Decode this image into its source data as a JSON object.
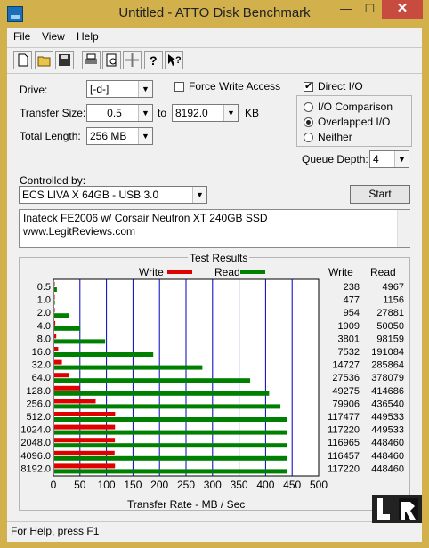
{
  "window": {
    "title": "Untitled - ATTO Disk Benchmark",
    "minimize": "—",
    "maximize": "☐",
    "close": "✕"
  },
  "menu": {
    "file": "File",
    "view": "View",
    "help": "Help"
  },
  "toolbar": {
    "new": "new-doc",
    "open": "open-folder",
    "save": "save-disk",
    "print": "printer",
    "preview": "print-preview",
    "move": "move-arrows",
    "help": "question",
    "context_help": "context-help"
  },
  "form": {
    "drive_label": "Drive:",
    "drive_value": "[-d-]",
    "force_write_label": "Force Write Access",
    "direct_io_label": "Direct I/O",
    "transfer_size_label": "Transfer Size:",
    "transfer_from": "0.5",
    "to_label": "to",
    "transfer_to": "8192.0",
    "kb_label": "KB",
    "total_length_label": "Total Length:",
    "total_length_value": "256 MB",
    "io_comparison_label": "I/O Comparison",
    "overlapped_io_label": "Overlapped I/O",
    "neither_label": "Neither",
    "queue_depth_label": "Queue Depth:",
    "queue_depth_value": "4",
    "controlled_by_label": "Controlled by:",
    "controlled_by_value": "ECS LIVA X 64GB - USB 3.0",
    "start_label": "Start",
    "notes_line1": "Inateck FE2006 w/ Corsair Neutron XT 240GB SSD",
    "notes_line2": "www.LegitReviews.com"
  },
  "results": {
    "group_title": "Test Results",
    "legend_write": "Write",
    "legend_read": "Read",
    "col_write": "Write",
    "col_read": "Read",
    "xaxis_label": "Transfer Rate - MB / Sec"
  },
  "status": {
    "text": "For Help, press F1"
  },
  "colors": {
    "write": "#e00000",
    "read": "#008000",
    "grid": "#0000c0"
  },
  "chart_data": {
    "type": "bar",
    "categories": [
      "0.5",
      "1.0",
      "2.0",
      "4.0",
      "8.0",
      "16.0",
      "32.0",
      "64.0",
      "128.0",
      "256.0",
      "512.0",
      "1024.0",
      "2048.0",
      "4096.0",
      "8192.0"
    ],
    "series": [
      {
        "name": "Write",
        "values": [
          238,
          477,
          954,
          1909,
          3801,
          7532,
          14727,
          27536,
          49275,
          79906,
          117477,
          117220,
          116965,
          116457,
          117220
        ]
      },
      {
        "name": "Read",
        "values": [
          4967,
          1156,
          27881,
          50050,
          98159,
          191084,
          285864,
          378079,
          414686,
          436540,
          449533,
          449533,
          448460,
          448460,
          448460
        ]
      }
    ],
    "value_units": "KB/s",
    "write_display": [
      "238",
      "477",
      "954",
      "1909",
      "3801",
      "7532",
      "14727",
      "27536",
      "49275",
      "79906",
      "117477",
      "117220",
      "116965",
      "116457",
      "117220"
    ],
    "read_display": [
      "4967",
      "1156",
      "27881",
      "50050",
      "98159",
      "191084",
      "285864",
      "378079",
      "414686",
      "436540",
      "449533",
      "449533",
      "448460",
      "448460",
      "448460"
    ],
    "xlabel": "Transfer Rate - MB / Sec",
    "xticks": [
      "0",
      "50",
      "100",
      "150",
      "200",
      "250",
      "300",
      "350",
      "400",
      "450",
      "500"
    ],
    "xlim": [
      0,
      500
    ],
    "grid": true
  }
}
